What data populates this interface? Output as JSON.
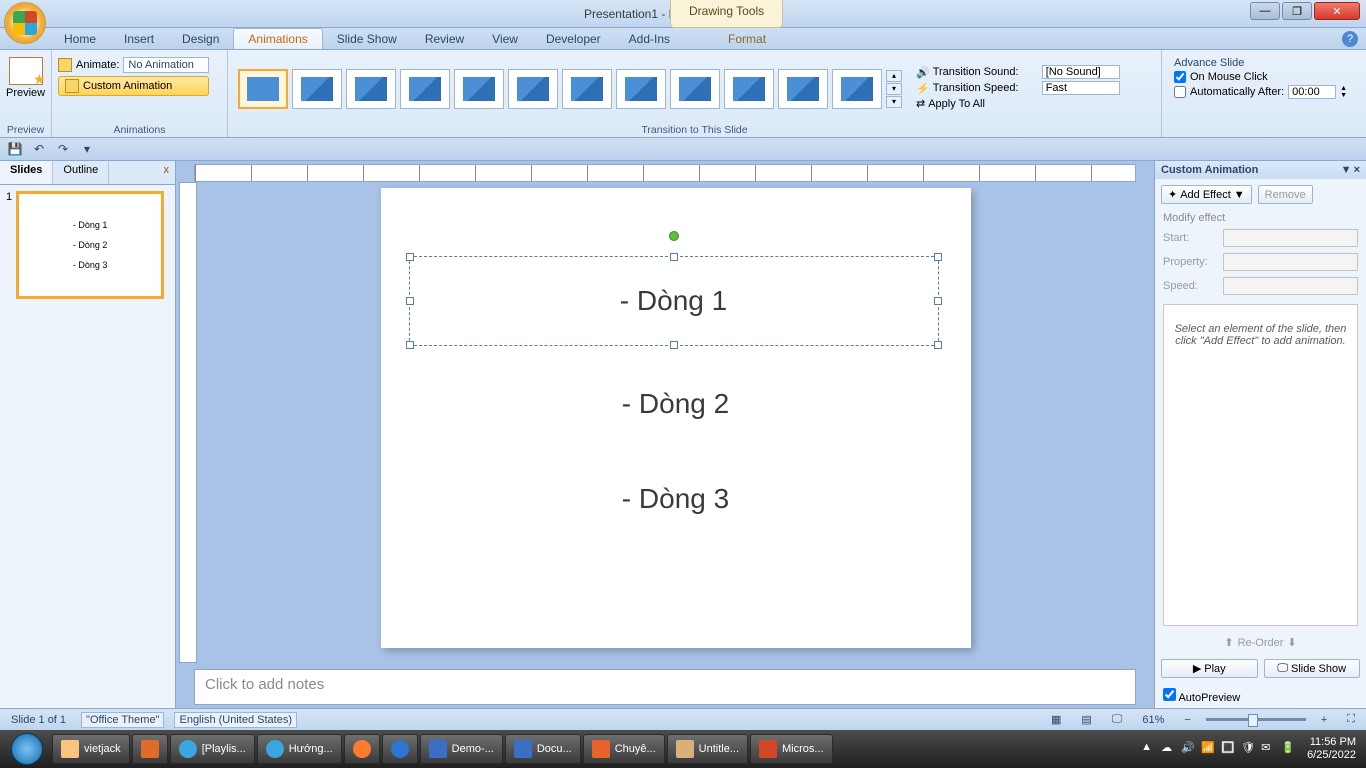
{
  "title": "Presentation1 - Microsoft PowerPoint",
  "drawing_tools": "Drawing Tools",
  "tabs": {
    "home": "Home",
    "insert": "Insert",
    "design": "Design",
    "animations": "Animations",
    "slideshow": "Slide Show",
    "review": "Review",
    "view": "View",
    "developer": "Developer",
    "addins": "Add-Ins",
    "format": "Format"
  },
  "ribbon": {
    "preview": {
      "label": "Preview",
      "group": "Preview"
    },
    "animations": {
      "animate_lbl": "Animate:",
      "animate_val": "No Animation",
      "custom": "Custom Animation",
      "group": "Animations"
    },
    "transition": {
      "group": "Transition to This Slide",
      "sound_lbl": "Transition Sound:",
      "sound_val": "[No Sound]",
      "speed_lbl": "Transition Speed:",
      "speed_val": "Fast",
      "apply": "Apply To All"
    },
    "advance": {
      "title": "Advance Slide",
      "mouse": "On Mouse Click",
      "auto": "Automatically After:",
      "time": "00:00"
    }
  },
  "slides_panel": {
    "tab1": "Slides",
    "tab2": "Outline",
    "t1": "- Dòng 1",
    "t2": "- Dòng 2",
    "t3": "- Dòng 3"
  },
  "slide": {
    "l1": "- Dòng 1",
    "l2": "- Dòng 2",
    "l3": "- Dòng 3"
  },
  "notes_placeholder": "Click to add notes",
  "ca": {
    "title": "Custom Animation",
    "add": "Add Effect",
    "remove": "Remove",
    "modify": "Modify effect",
    "start": "Start:",
    "property": "Property:",
    "speed": "Speed:",
    "hint": "Select an element of the slide, then click \"Add Effect\" to add animation.",
    "reorder": "Re-Order",
    "play": "Play",
    "slideshow": "Slide Show",
    "autoprev": "AutoPreview"
  },
  "status": {
    "slide": "Slide 1 of 1",
    "theme": "\"Office Theme\"",
    "lang": "English (United States)",
    "zoom": "61%"
  },
  "taskbar": {
    "items": [
      "vietjack",
      "[Playlis...",
      "Hướng...",
      "Demo-...",
      "Docu...",
      "Chuyê...",
      "Untitle...",
      "Micros..."
    ],
    "time": "11:56 PM",
    "date": "6/25/2022"
  }
}
